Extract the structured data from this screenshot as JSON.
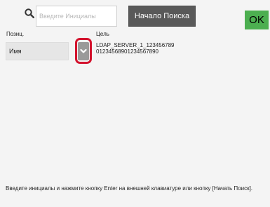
{
  "search": {
    "placeholder": "Введите Инициалы",
    "button": "Начало Поиска"
  },
  "ok_button": "OK",
  "columns": {
    "position": "Позиц.",
    "target": "Цель"
  },
  "position_field": {
    "value": "Имя"
  },
  "target_lines": [
    "LDAP_SERVER_1_123456789",
    "01234568901234567890"
  ],
  "instruction": "Введите инициалы и нажмите кнопку Enter на внешней клавиатуре или кнопку [Начать Поиск].",
  "colors": {
    "ok": "#4caf50",
    "highlight": "#d3132d",
    "button": "#595959"
  },
  "icons": {
    "search": "search-icon",
    "dropdown": "chevron-down-icon"
  }
}
